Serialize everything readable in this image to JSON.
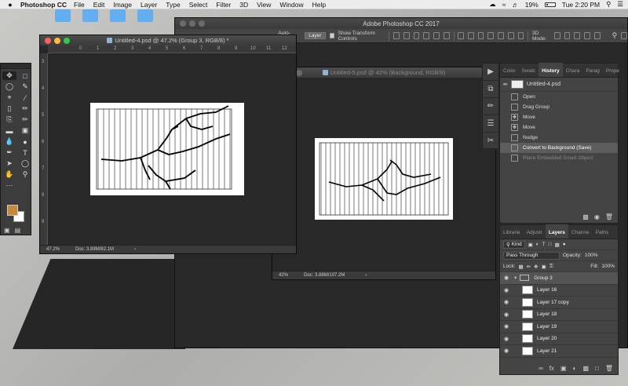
{
  "menubar": {
    "apple": "",
    "app_name": "Photoshop CC",
    "items": [
      "File",
      "Edit",
      "Image",
      "Layer",
      "Type",
      "Select",
      "Filter",
      "3D",
      "View",
      "Window",
      "Help"
    ],
    "battery": "19%",
    "clock": "Tue 2:20 PM"
  },
  "main_window": {
    "title": "Adobe Photoshop CC 2017",
    "auto_select_label": "Auto-Select:",
    "auto_select_value": "Layer",
    "transform_label": "Show Transform Controls",
    "mode_label": "3D Mode:"
  },
  "doc4": {
    "title": "Untitled-4.psd @ 47.2% (Group 3, RGB/8) *",
    "zoom": "47.2%",
    "doc_size": "Doc: 3.89M/82.1M",
    "ruler_h": [
      "0",
      "1",
      "2",
      "3",
      "4",
      "5",
      "6",
      "7",
      "8",
      "9",
      "10",
      "11",
      "12"
    ],
    "ruler_v": [
      "3",
      "4",
      "5",
      "6",
      "7",
      "8",
      "9"
    ]
  },
  "doc5": {
    "title": "Untitled-5.psd @ 42% (Background, RGB/8)",
    "zoom": "42%",
    "doc_size": "Doc: 3.88M/107.2M"
  },
  "history": {
    "tabs": [
      "Color",
      "Swatc",
      "History",
      "Chara",
      "Parag",
      "Prope"
    ],
    "active_tab": "History",
    "snapshot": "Untitled-4.psd",
    "steps": [
      "Open",
      "Drag Group",
      "Move",
      "Move",
      "Nudge",
      "Convert to Background (Save)",
      "Place Embedded Smart Object"
    ]
  },
  "layers": {
    "tabs": [
      "Librarie",
      "Adjustr",
      "Layers",
      "Channe",
      "Paths"
    ],
    "active_tab": "Layers",
    "kind_label": "Kind",
    "blend_mode": "Pass Through",
    "opacity_label": "Opacity:",
    "opacity": "100%",
    "lock_label": "Lock:",
    "fill_label": "Fill:",
    "fill": "100%",
    "group_name": "Group 3",
    "items": [
      "Layer 16",
      "Layer 17 copy",
      "Layer 18",
      "Layer 19",
      "Layer 20",
      "Layer 21"
    ],
    "footer_fx": "fx"
  },
  "colors": {
    "foreground": "#c48a3c",
    "background": "#ffffff"
  }
}
